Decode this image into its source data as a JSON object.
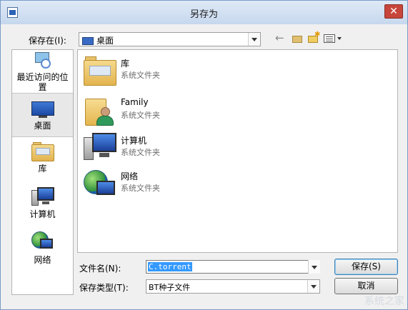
{
  "window": {
    "title": "另存为",
    "close_glyph": "✕"
  },
  "location": {
    "label": "保存在(I):",
    "value": "桌面"
  },
  "toolbar": {
    "back_glyph": "←"
  },
  "places": [
    {
      "label": "最近访问的位置",
      "icon": "recent-places-icon"
    },
    {
      "label": "桌面",
      "icon": "desktop-icon",
      "selected": true
    },
    {
      "label": "库",
      "icon": "library-icon"
    },
    {
      "label": "计算机",
      "icon": "computer-icon"
    },
    {
      "label": "网络",
      "icon": "network-icon"
    }
  ],
  "files": [
    {
      "name": "库",
      "type": "系统文件夹",
      "icon": "library-icon"
    },
    {
      "name": "Family",
      "type": "系统文件夹",
      "icon": "user-folder-icon"
    },
    {
      "name": "计算机",
      "type": "系统文件夹",
      "icon": "computer-icon"
    },
    {
      "name": "网络",
      "type": "系统文件夹",
      "icon": "network-icon"
    }
  ],
  "form": {
    "filename_label": "文件名(N):",
    "filename_value": "C.torrent",
    "filetype_label": "保存类型(T):",
    "filetype_value": "BT种子文件"
  },
  "buttons": {
    "save": "保存(S)",
    "cancel": "取消"
  },
  "watermark": "系统之家"
}
